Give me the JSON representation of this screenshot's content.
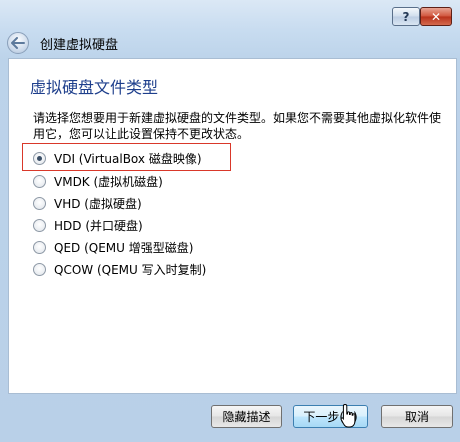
{
  "window": {
    "help_label": "?",
    "close_label": "✕"
  },
  "nav": {
    "back_icon": "back-arrow-icon",
    "title": "创建虚拟硬盘"
  },
  "page": {
    "heading": "虚拟硬盘文件类型",
    "description": "请选择您想要用于新建虚拟硬盘的文件类型。如果您不需要其他虚拟化软件使用它，您可以让此设置保持不更改状态。"
  },
  "options": [
    {
      "label": "VDI (VirtualBox 磁盘映像)",
      "checked": true
    },
    {
      "label": "VMDK (虚拟机磁盘)",
      "checked": false
    },
    {
      "label": "VHD (虚拟硬盘)",
      "checked": false
    },
    {
      "label": "HDD (并口硬盘)",
      "checked": false
    },
    {
      "label": "QED (QEMU 增强型磁盘)",
      "checked": false
    },
    {
      "label": "QCOW (QEMU 写入时复制)",
      "checked": false
    }
  ],
  "footer": {
    "hide_description": "隐藏描述",
    "next": "下一步(N)",
    "cancel": "取消"
  },
  "colors": {
    "heading": "#1e3f8c",
    "highlight_border": "#d9382a",
    "window_bg": "#bcd3ea"
  }
}
